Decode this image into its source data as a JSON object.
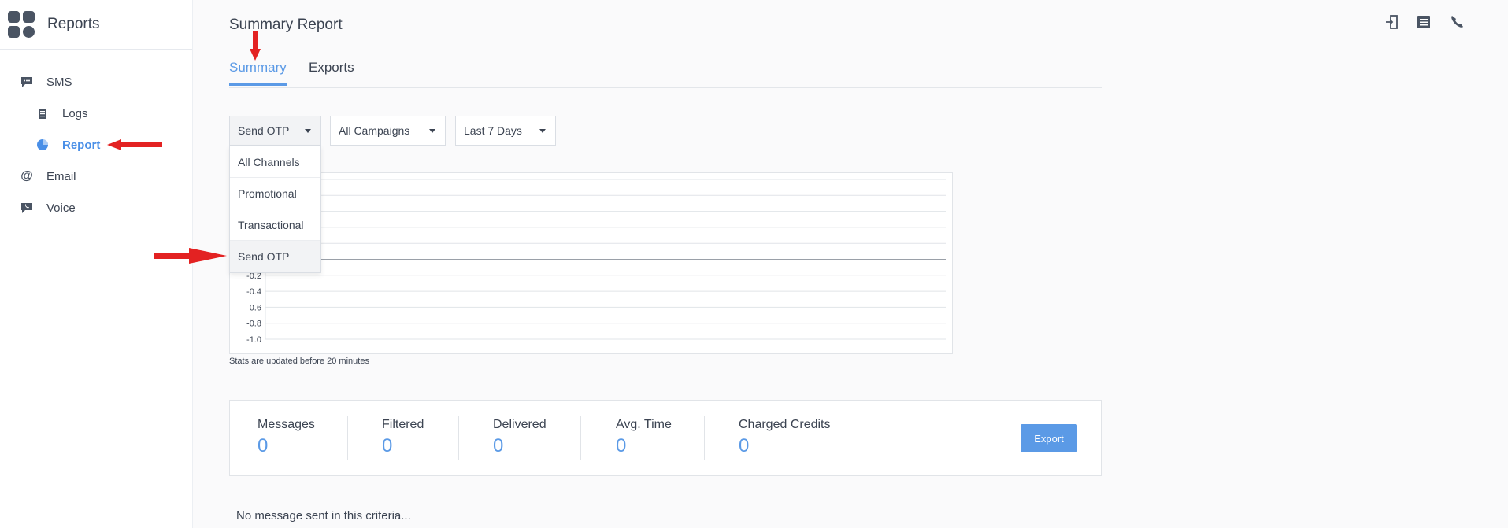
{
  "app": {
    "title": "Reports"
  },
  "sidebar": {
    "items": [
      {
        "label": "SMS",
        "icon": "sms-icon"
      },
      {
        "label": "Logs",
        "icon": "logs-icon"
      },
      {
        "label": "Report",
        "icon": "pie-chart-icon",
        "active": true
      },
      {
        "label": "Email",
        "icon": "at-icon"
      },
      {
        "label": "Voice",
        "icon": "voice-icon"
      }
    ]
  },
  "header": {
    "title": "Summary Report",
    "icons": [
      "logout-icon",
      "billing-icon",
      "phone-icon"
    ]
  },
  "tabs": [
    {
      "label": "Summary",
      "active": true
    },
    {
      "label": "Exports",
      "active": false
    }
  ],
  "filters": {
    "channel": "Send OTP",
    "campaign": "All Campaigns",
    "period": "Last 7 Days"
  },
  "channel_dropdown": {
    "options": [
      "All Channels",
      "Promotional",
      "Transactional",
      "Send OTP"
    ],
    "selected": "Send OTP"
  },
  "chart_data": {
    "type": "line",
    "series": [],
    "y_ticks": [
      "-0.2",
      "-0.4",
      "-0.6",
      "-0.8",
      "-1.0"
    ],
    "ylim": [
      -1.0,
      1.0
    ],
    "grid": true
  },
  "chart_note": "Stats are updated before 20 minutes",
  "stats": [
    {
      "label": "Messages",
      "value": "0"
    },
    {
      "label": "Filtered",
      "value": "0"
    },
    {
      "label": "Delivered",
      "value": "0"
    },
    {
      "label": "Avg. Time",
      "value": "0"
    },
    {
      "label": "Charged Credits",
      "value": "0"
    }
  ],
  "export_label": "Export",
  "empty_message": "No message sent in this criteria...",
  "colors": {
    "accent": "#5b9ae6",
    "arrow": "#e32222",
    "text": "#3c4452"
  }
}
